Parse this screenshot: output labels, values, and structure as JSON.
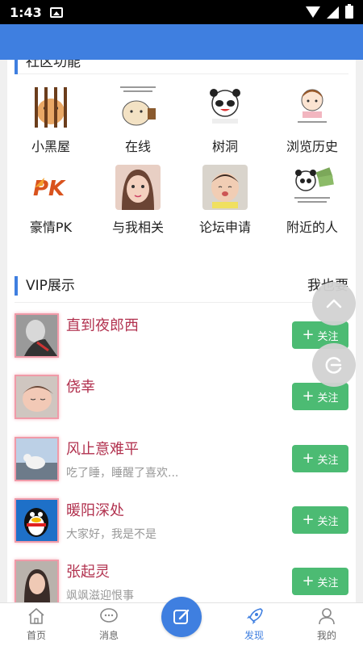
{
  "status": {
    "time": "1:43"
  },
  "features": {
    "title": "社区功能",
    "items": [
      {
        "label": "小黑屋",
        "icon": "jail-icon"
      },
      {
        "label": "在线",
        "icon": "online-icon"
      },
      {
        "label": "树洞",
        "icon": "tree-hole-icon"
      },
      {
        "label": "浏览历史",
        "icon": "history-icon"
      },
      {
        "label": "豪情PK",
        "icon": "pk-icon"
      },
      {
        "label": "与我相关",
        "icon": "related-icon"
      },
      {
        "label": "论坛申请",
        "icon": "forum-apply-icon"
      },
      {
        "label": "附近的人",
        "icon": "nearby-icon"
      }
    ]
  },
  "vip": {
    "title": "VIP展示",
    "more": "我也要",
    "follow_label": "关注",
    "users": [
      {
        "name": "直到夜郎西",
        "bio": ""
      },
      {
        "name": "侥幸",
        "bio": ""
      },
      {
        "name": "风止意难平",
        "bio": "吃了睡，睡醒了喜欢..."
      },
      {
        "name": "暖阳深处",
        "bio": "大家好，我是不是"
      },
      {
        "name": "张起灵",
        "bio": "飒飒滋迎恨事"
      }
    ]
  },
  "tabs": [
    {
      "label": "首页",
      "icon": "home-icon"
    },
    {
      "label": "消息",
      "icon": "message-icon"
    },
    {
      "label": "",
      "icon": "compose-icon"
    },
    {
      "label": "发现",
      "icon": "rocket-icon"
    },
    {
      "label": "我的",
      "icon": "profile-icon"
    }
  ],
  "colors": {
    "accent": "#3f7fe0",
    "follow": "#4cbb73",
    "name": "#b2324f"
  }
}
